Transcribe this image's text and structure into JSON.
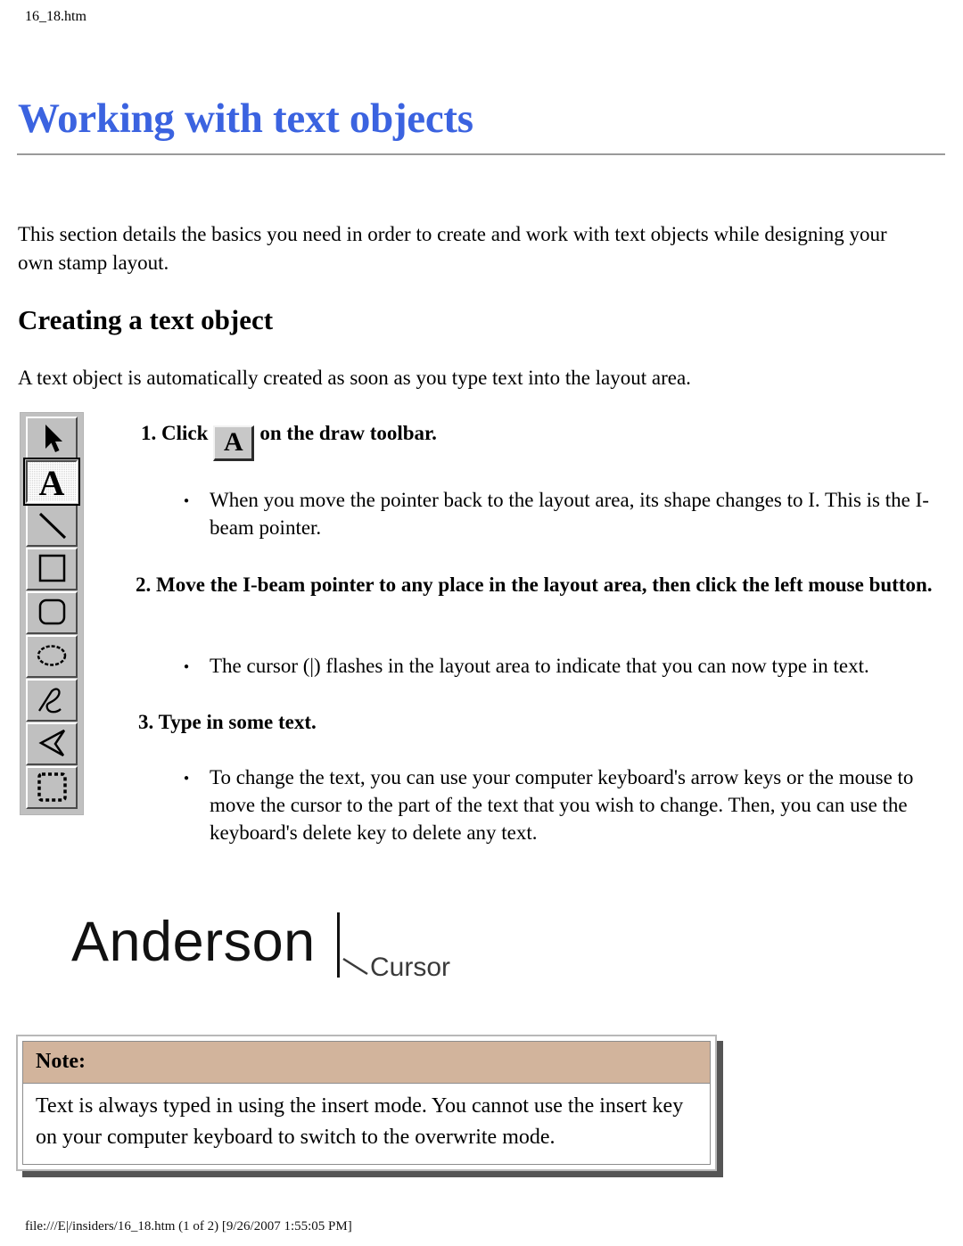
{
  "page": {
    "file_tab": "16_18.htm",
    "title": "Working with text objects",
    "title_color": "#3b63e0",
    "footer": "file:///E|/insiders/16_18.htm (1 of 2) [9/26/2007 1:55:05 PM]"
  },
  "content": {
    "intro_paragraph": "This section details the basics you need in order to create and work with text objects while designing your own stamp layout.",
    "section_heading": "Creating a text object",
    "auto_paragraph": "A text object is automatically created as soon as you type text into the layout area.",
    "steps": [
      {
        "number": "1.",
        "text_before": "Click",
        "inline_button_label": "A",
        "text_after": "on the draw toolbar."
      },
      {
        "number": "2.",
        "text": "Move the I-beam pointer to any place in the layout area, then click the left mouse button."
      },
      {
        "number": "3.",
        "text": "Type in some text."
      }
    ],
    "bullets": [
      "When you move the pointer back to the layout area, its shape changes to I. This is the I-beam pointer.",
      "The cursor (|) flashes in the layout area to indicate that you can now type in text.",
      "To change the text, you can use your computer keyboard's arrow keys or the mouse to move the cursor to the part of the text that you wish to change. Then, you can use the keyboard's delete key to delete any text."
    ]
  },
  "toolbar": {
    "name": "draw-toolbar",
    "background_color": "#c0c0c0",
    "buttons": [
      {
        "icon": "pointer-arrow-icon",
        "selected": false
      },
      {
        "icon": "text-tool-icon",
        "label": "A",
        "selected": true
      },
      {
        "icon": "line-tool-icon",
        "selected": false
      },
      {
        "icon": "rectangle-tool-icon",
        "selected": false
      },
      {
        "icon": "rounded-rectangle-tool-icon",
        "selected": false
      },
      {
        "icon": "ellipse-tool-icon",
        "selected": false
      },
      {
        "icon": "freehand-tool-icon",
        "selected": false
      },
      {
        "icon": "polygon-tool-icon",
        "selected": false
      },
      {
        "icon": "select-region-tool-icon",
        "selected": false
      }
    ]
  },
  "figure": {
    "word": "Anderson",
    "caret_label": "Cursor"
  },
  "note": {
    "heading": "Note:",
    "heading_color": "#d2b49c",
    "body": "Text is always typed in using the insert mode. You cannot use the insert key on your computer keyboard to switch to the overwrite mode."
  }
}
